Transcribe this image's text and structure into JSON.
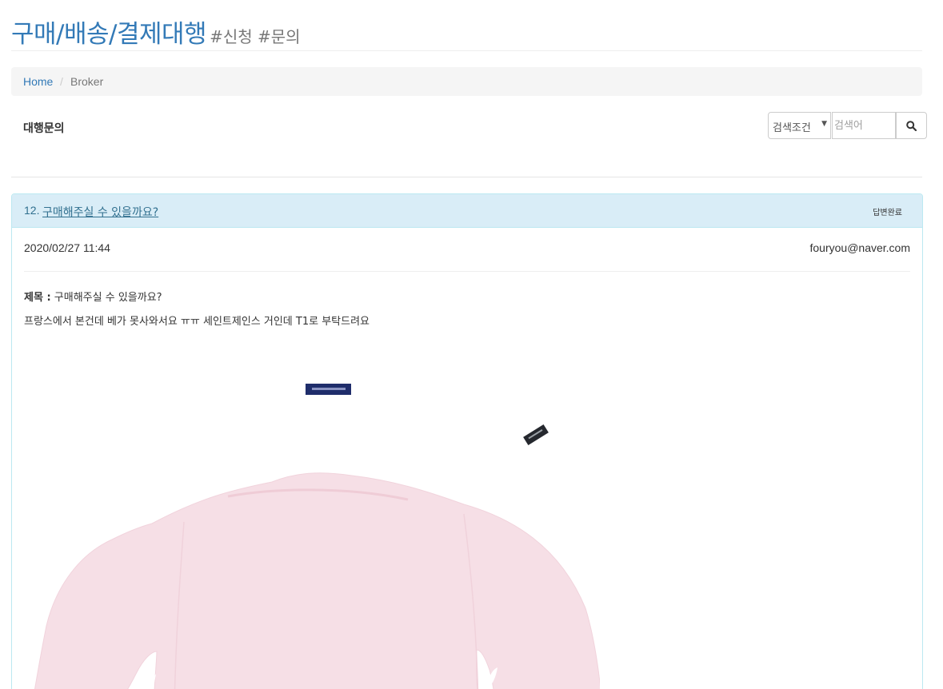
{
  "header": {
    "title": "구매/배송/결제대행",
    "tags": "#신청 #문의"
  },
  "breadcrumb": {
    "home": "Home",
    "separator": "/",
    "current": "Broker"
  },
  "section": {
    "label": "대행문의"
  },
  "search": {
    "condition": "검색조건",
    "placeholder": "검색어",
    "button_icon": "search-icon"
  },
  "post": {
    "number": "12.",
    "title": "구매해주실 수 있을까요?",
    "status": "답변완료",
    "date": "2020/02/27 11:44",
    "author": "fouryou@naver.com",
    "subject_label": "제목 :",
    "subject": "구매해주실 수 있을까요?",
    "body": "프랑스에서 본건데 베가 못사와서요 ㅠㅠ 세인트제인스 거인데 T1로 부탁드려요"
  },
  "colors": {
    "link": "#337ab7",
    "panel_heading_bg": "#d9edf7",
    "panel_border": "#bce8f1",
    "sweater": "#f6dfe6"
  }
}
